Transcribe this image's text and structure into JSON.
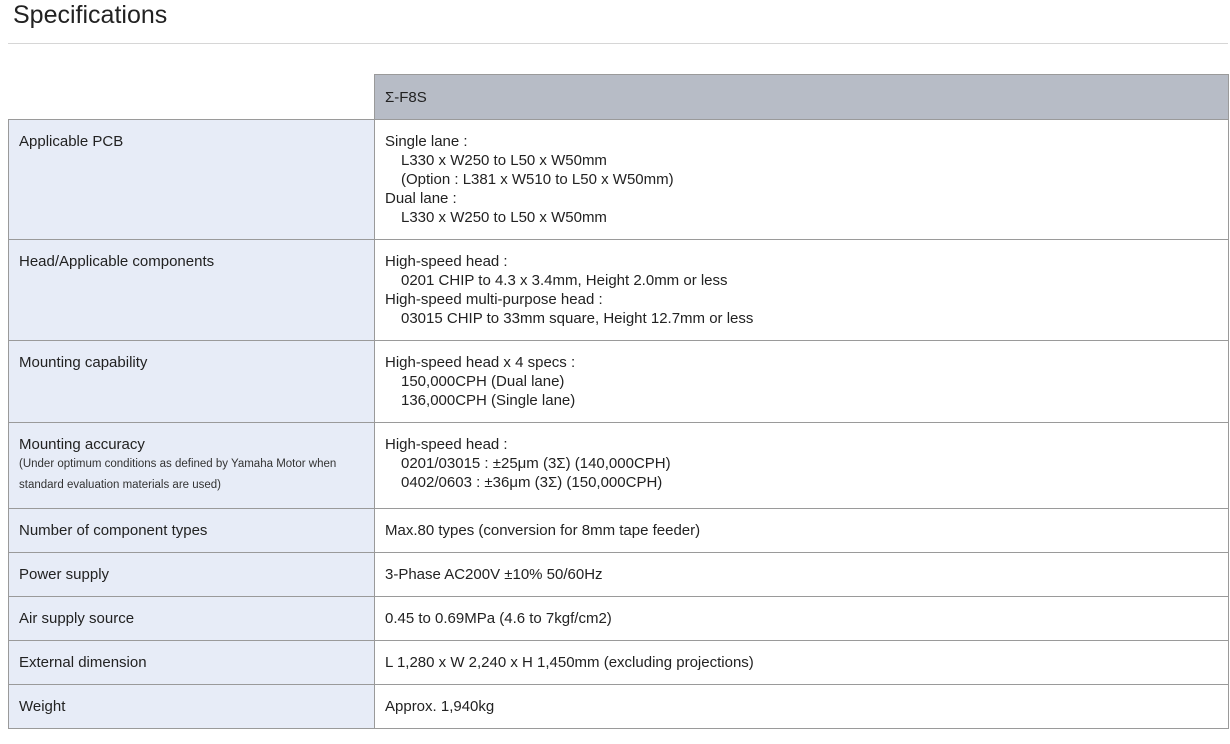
{
  "page": {
    "title": "Specifications"
  },
  "table": {
    "model": "Σ-F8S",
    "rows": [
      {
        "label": "Applicable PCB",
        "lines": [
          {
            "text": "Single lane :",
            "indent": false
          },
          {
            "text": "L330 x W250 to L50 x W50mm",
            "indent": true
          },
          {
            "text": "(Option : L381 x W510 to L50 x W50mm)",
            "indent": true
          },
          {
            "text": "Dual lane :",
            "indent": false
          },
          {
            "text": "L330 x W250 to L50 x W50mm",
            "indent": true
          }
        ]
      },
      {
        "label": "Head/Applicable components",
        "lines": [
          {
            "text": "High-speed head :",
            "indent": false
          },
          {
            "text": "0201 CHIP to 4.3 x 3.4mm, Height 2.0mm or less",
            "indent": true
          },
          {
            "text": "High-speed multi-purpose head :",
            "indent": false
          },
          {
            "text": "03015 CHIP to 33mm square, Height 12.7mm or less",
            "indent": true
          }
        ]
      },
      {
        "label": "Mounting capability",
        "lines": [
          {
            "text": "High-speed head x 4 specs :",
            "indent": false
          },
          {
            "text": "150,000CPH (Dual lane)",
            "indent": true
          },
          {
            "text": "136,000CPH (Single lane)",
            "indent": true
          }
        ]
      },
      {
        "label": "Mounting accuracy",
        "note": "(Under optimum conditions as defined by Yamaha Motor when standard evaluation materials are used)",
        "lines": [
          {
            "text": "High-speed head :",
            "indent": false
          },
          {
            "text": "0201/03015 : ±25μm (3Σ) (140,000CPH)",
            "indent": true
          },
          {
            "text": "0402/0603 : ±36μm (3Σ) (150,000CPH)",
            "indent": true
          }
        ]
      },
      {
        "label": "Number of component types",
        "lines": [
          {
            "text": "Max.80 types (conversion for 8mm tape feeder)",
            "indent": false
          }
        ]
      },
      {
        "label": "Power supply",
        "lines": [
          {
            "text": "3-Phase AC200V ±10% 50/60Hz",
            "indent": false
          }
        ]
      },
      {
        "label": "Air supply source",
        "lines": [
          {
            "text": "0.45 to 0.69MPa (4.6 to 7kgf/cm2)",
            "indent": false
          }
        ]
      },
      {
        "label": "External dimension",
        "lines": [
          {
            "text": "L 1,280 x W 2,240 x H 1,450mm (excluding projections)",
            "indent": false
          }
        ]
      },
      {
        "label": "Weight",
        "lines": [
          {
            "text": "Approx. 1,940kg",
            "indent": false
          }
        ]
      }
    ]
  }
}
